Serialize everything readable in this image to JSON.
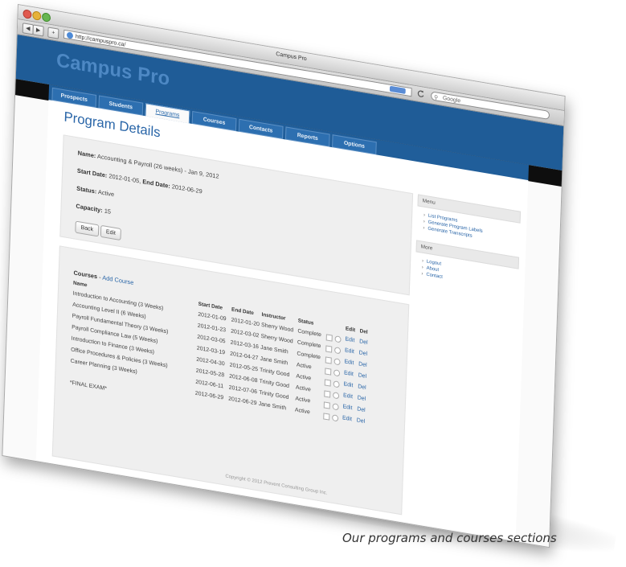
{
  "browser": {
    "window_title": "Campus Pro",
    "url": "http://campuspro.ca/",
    "search_placeholder": "Google"
  },
  "site": {
    "logo": "Campus Pro",
    "nav": [
      "Prospects",
      "Students",
      "Programs",
      "Courses",
      "Contacts",
      "Reports",
      "Options"
    ],
    "active_nav": "Programs"
  },
  "page": {
    "title": "Program Details",
    "name_label": "Name:",
    "name_value": "Accounting & Payroll (26 weeks) - Jan 9, 2012",
    "start_label": "Start Date:",
    "start_value": "2012-01-05,",
    "end_label": "End Date:",
    "end_value": "2012-06-29",
    "status_label": "Status:",
    "status_value": "Active",
    "capacity_label": "Capacity:",
    "capacity_value": "15",
    "back_button": "Back",
    "edit_button": "Edit"
  },
  "courses": {
    "heading": "Courses",
    "add_link": "Add Course",
    "columns": {
      "name": "Name",
      "start": "Start Date",
      "end": "End Date",
      "instructor": "Instructor",
      "status": "Status",
      "edit": "Edit",
      "del": "Del"
    },
    "rows": [
      {
        "name": "Introduction to Accounting (3 Weeks)",
        "start": "2012-01-09",
        "end": "2012-01-20",
        "instructor": "Sherry Wood",
        "status": "Complete"
      },
      {
        "name": "Accounting Level II (6 Weeks)",
        "start": "2012-01-23",
        "end": "2012-03-02",
        "instructor": "Sherry Wood",
        "status": "Complete"
      },
      {
        "name": "Payroll Fundamental Theory (3 Weeks)",
        "start": "2012-03-05",
        "end": "2012-03-16",
        "instructor": "Jane Smith",
        "status": "Complete"
      },
      {
        "name": "Payroll Compliance Law (5 Weeks)",
        "start": "2012-03-19",
        "end": "2012-04-27",
        "instructor": "Jane Smith",
        "status": "Active"
      },
      {
        "name": "Introduction to Finance (3 Weeks)",
        "start": "2012-04-30",
        "end": "2012-05-25",
        "instructor": "Trinity Good",
        "status": "Active"
      },
      {
        "name": "Office Procedures & Policies (3 Weeks)",
        "start": "2012-05-28",
        "end": "2012-06-08",
        "instructor": "Trinity Good",
        "status": "Active"
      },
      {
        "name": "Career Planning (3 Weeks)",
        "start": "2012-06-11",
        "end": "2012-07-06",
        "instructor": "Trinity Good",
        "status": "Active"
      },
      {
        "name": "",
        "start": "2012-06-29",
        "end": "2012-06-29",
        "instructor": "Jane Smith",
        "status": "Active"
      }
    ],
    "final_exam": "*FINAL EXAM*",
    "edit_link": "Edit",
    "del_link": "Del"
  },
  "sidebar": {
    "menu_title": "Menu",
    "menu_items": [
      "List Programs",
      "Generate Program Labels",
      "Generate Transcripts"
    ],
    "more_title": "More",
    "more_items": [
      "Logout",
      "About",
      "Contact"
    ]
  },
  "footer": "Copyright © 2012 Prevent Consulting Group Inc.",
  "caption": "Our programs and courses sections"
}
